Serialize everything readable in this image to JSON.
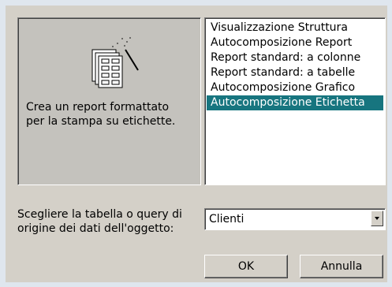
{
  "preview": {
    "icon": "report-labels-wizard-icon",
    "description": "Crea un report formattato\nper la stampa su etichette."
  },
  "report_types": [
    {
      "label": "Visualizzazione Struttura",
      "selected": false
    },
    {
      "label": "Autocomposizione Report",
      "selected": false
    },
    {
      "label": "Report standard: a colonne",
      "selected": false
    },
    {
      "label": "Report standard: a tabelle",
      "selected": false
    },
    {
      "label": "Autocomposizione Grafico",
      "selected": false
    },
    {
      "label": "Autocomposizione Etichetta",
      "selected": true
    }
  ],
  "source": {
    "label": "Scegliere la tabella o query di\norigine dei dati dell'oggetto:",
    "value": "Clienti"
  },
  "buttons": {
    "ok": "OK",
    "cancel": "Annulla"
  },
  "colors": {
    "selection": "#17757f",
    "dialog": "#d4d0c8"
  }
}
